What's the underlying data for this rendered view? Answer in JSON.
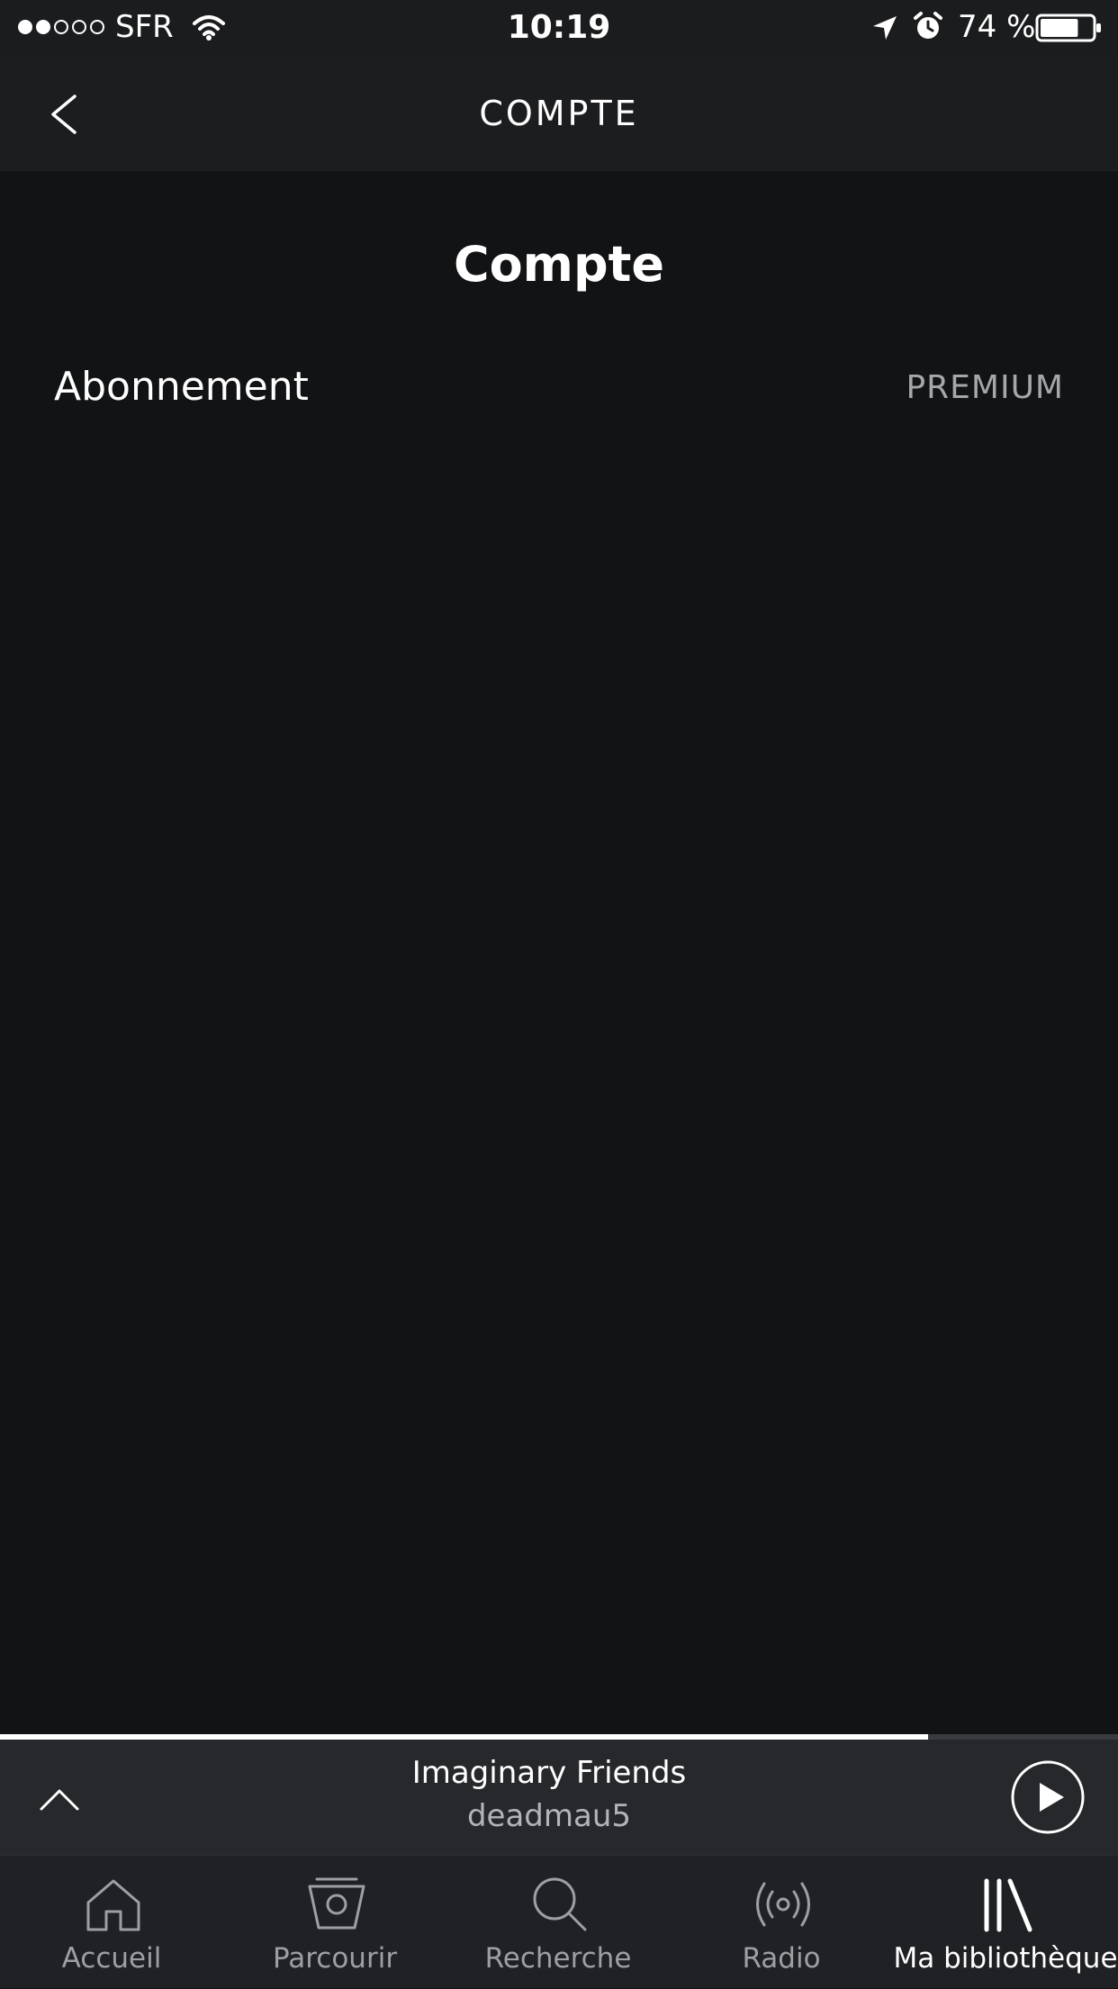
{
  "status_bar": {
    "carrier": "SFR",
    "time": "10:19",
    "battery": "74 %",
    "battery_level": 0.74,
    "signal_bars_filled": 2,
    "signal_bars_total": 5,
    "icons": [
      "wifi-icon",
      "location-arrow-icon",
      "alarm-icon",
      "battery-icon"
    ]
  },
  "header": {
    "title": "COMPTE",
    "back_icon": "chevron-left-icon"
  },
  "page": {
    "title": "Compte",
    "rows": [
      {
        "label": "Abonnement",
        "value": "PREMIUM"
      }
    ]
  },
  "player": {
    "progress": 0.83,
    "track_title": "Imaginary Friends",
    "artist": "deadmau5",
    "expand_icon": "chevron-up-icon",
    "play_icon": "play-icon"
  },
  "tab_bar": {
    "tabs": [
      {
        "label": "Accueil",
        "icon": "home-icon",
        "active": false
      },
      {
        "label": "Parcourir",
        "icon": "browse-icon",
        "active": false
      },
      {
        "label": "Recherche",
        "icon": "search-icon",
        "active": false
      },
      {
        "label": "Radio",
        "icon": "radio-icon",
        "active": false
      },
      {
        "label": "Ma bibliothèque",
        "icon": "library-icon",
        "active": true
      }
    ]
  },
  "colors": {
    "background": "#121315",
    "header": "#1c1d1f",
    "player_bar": "#27282c",
    "tab_bar": "#202124",
    "muted_text": "#a6a7aa"
  }
}
